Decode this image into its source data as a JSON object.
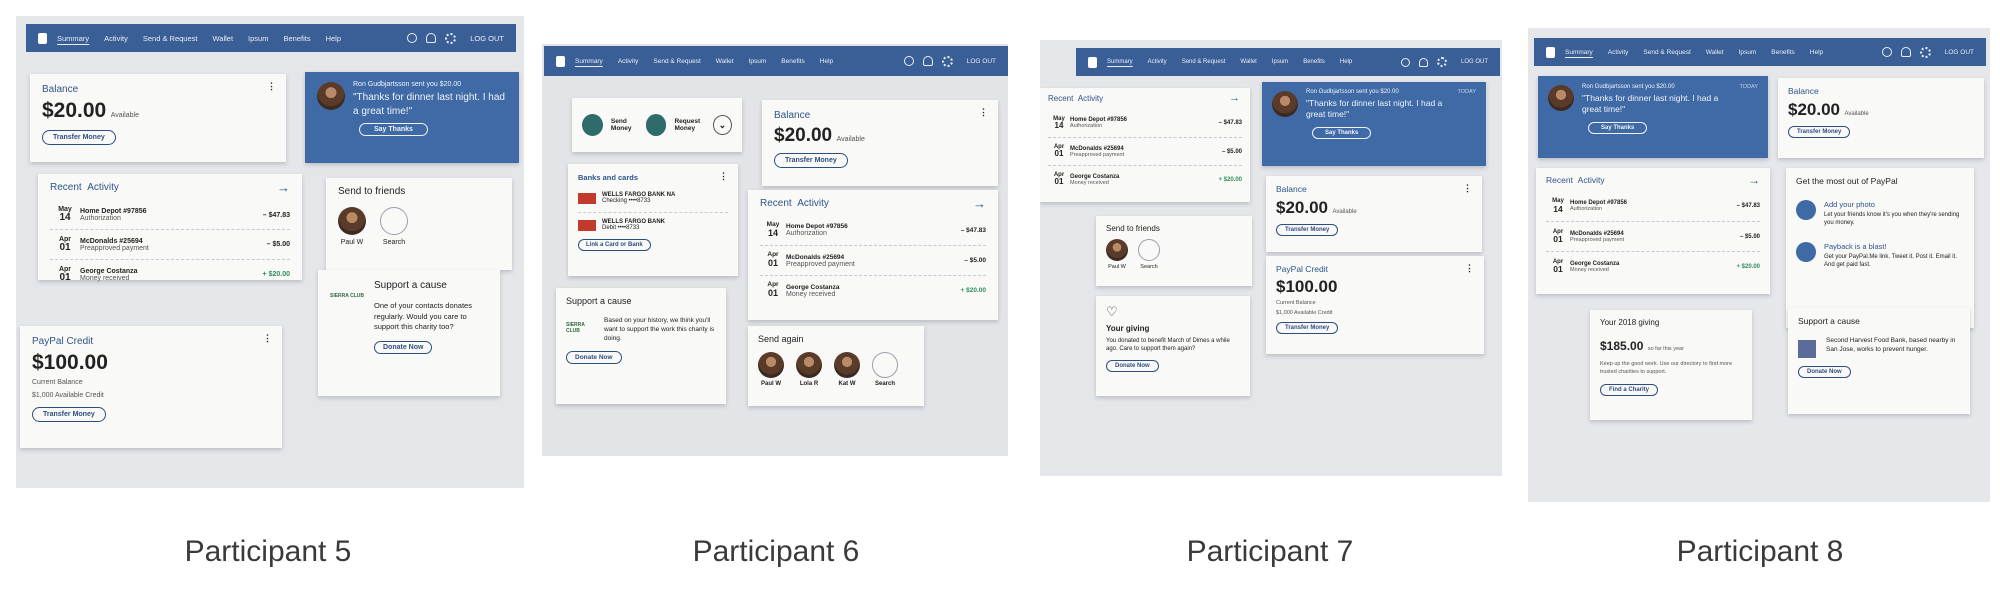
{
  "participants": [
    "Participant 5",
    "Participant 6",
    "Participant 7",
    "Participant 8"
  ],
  "nav": {
    "items": [
      "Summary",
      "Activity",
      "Send & Request",
      "Wallet",
      "Ipsum",
      "Benefits",
      "Help"
    ],
    "logout": "LOG OUT"
  },
  "balance": {
    "title": "Balance",
    "amount": "$20.00",
    "available": "Available",
    "button": "Transfer Money"
  },
  "message": {
    "from": "Ron Gudbjartsson sent you $20.00",
    "quote": "\"Thanks for dinner last night. I had a great time!\"",
    "button": "Say Thanks",
    "time": "TODAY"
  },
  "activity": {
    "title_a": "Recent",
    "title_b": "Activity",
    "rows": [
      {
        "month": "May",
        "day": "14",
        "name": "Home Depot #97856",
        "sub": "Authorization",
        "amount": "– $47.83"
      },
      {
        "month": "Apr",
        "day": "01",
        "name": "McDonalds #25694",
        "sub": "Preapproved payment",
        "amount": "– $5.00"
      },
      {
        "month": "Apr",
        "day": "01",
        "name": "George Costanza",
        "sub": "Money received",
        "amount": "+ $20.00"
      }
    ]
  },
  "friends": {
    "title": "Send to friends",
    "person": "Paul W",
    "search": "Search"
  },
  "cause": {
    "title": "Support a cause",
    "org": "SIERRA CLUB",
    "text5": "One of your contacts donates regularly. Would you care to support this charity too?",
    "text6": "Based on your history, we think you'll want to support the work this charity is doing.",
    "text8": "Second Harvest Food Bank, based nearby in San Jose, works to prevent hunger.",
    "button": "Donate Now"
  },
  "credit": {
    "title": "PayPal Credit",
    "amount": "$100.00",
    "current": "Current Balance",
    "avail": "$1,000 Available Credit",
    "button": "Transfer Money"
  },
  "quick": {
    "send": "Send Money",
    "request": "Request Money"
  },
  "banks": {
    "title": "Banks and cards",
    "b1": "WELLS FARGO BANK NA",
    "b1s": "Checking ••••8733",
    "b2": "WELLS FARGO BANK",
    "b2s": "Debit ••••8733",
    "link": "Link a Card or Bank"
  },
  "sendagain": {
    "title": "Send again",
    "p1": "Paul W",
    "p2": "Lola R",
    "p3": "Kat W",
    "search": "Search"
  },
  "giving7": {
    "title": "Your giving",
    "text": "You donated to benefit March of Dimes a while ago. Care to support them again?",
    "button": "Donate Now"
  },
  "giving8": {
    "title": "Your 2018 giving",
    "amount": "$185.00",
    "suffix": "so far this year",
    "text": "Keep up the good work. Use our directory to find more trusted charities to support.",
    "button": "Find a Charity"
  },
  "paypalmost": {
    "title": "Get the most out of PayPal",
    "h1": "Add your photo",
    "t1": "Let your friends know it's you when they're sending you money.",
    "h2": "Payback is a blast!",
    "t2": "Get your PayPal.Me link. Tweet it. Post it. Email it. And get paid fast."
  },
  "colors": {
    "nav": "#3a5f96",
    "accent": "#2f5487",
    "positive": "#2d8e5b"
  },
  "icons": [
    "paypal-logo",
    "search-icon",
    "bell-icon",
    "gear-icon",
    "arrow-right-icon",
    "send-icon",
    "request-icon",
    "chevron-down-icon",
    "heart-icon",
    "camera-icon",
    "link-icon"
  ]
}
